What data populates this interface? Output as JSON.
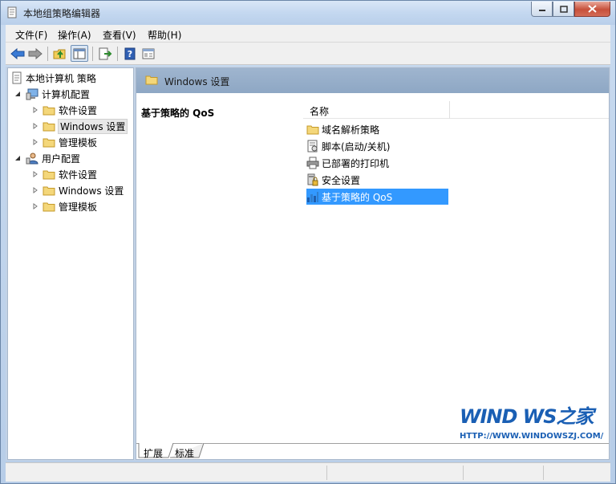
{
  "window": {
    "title": "本地组策略编辑器"
  },
  "menu": [
    "文件(F)",
    "操作(A)",
    "查看(V)",
    "帮助(H)"
  ],
  "toolbar": {
    "icons": [
      "back-arrow-icon",
      "forward-arrow-icon",
      "up-folder-icon",
      "show-hide-console-tree-icon",
      "export-list-icon",
      "help-icon",
      "properties-icon"
    ]
  },
  "tree": {
    "root": "本地计算机 策略",
    "computer": {
      "label": "计算机配置",
      "children": [
        "软件设置",
        "Windows 设置",
        "管理模板"
      ]
    },
    "user": {
      "label": "用户配置",
      "children": [
        "软件设置",
        "Windows 设置",
        "管理模板"
      ]
    }
  },
  "right": {
    "header": "Windows 设置",
    "left_title": "基于策略的 QoS",
    "column_name": "名称",
    "items": [
      {
        "label": "域名解析策略",
        "icon": "folder-icon"
      },
      {
        "label": "脚本(启动/关机)",
        "icon": "script-icon"
      },
      {
        "label": "已部署的打印机",
        "icon": "printer-icon"
      },
      {
        "label": "安全设置",
        "icon": "security-settings-icon"
      },
      {
        "label": "基于策略的 QoS",
        "icon": "qos-bar-chart-icon"
      }
    ],
    "tabs": [
      "扩展",
      "标准"
    ]
  },
  "watermark": {
    "brand": "WIND  WS之家",
    "url": "HTTP://WWW.WINDOWSZJ.COM/"
  }
}
